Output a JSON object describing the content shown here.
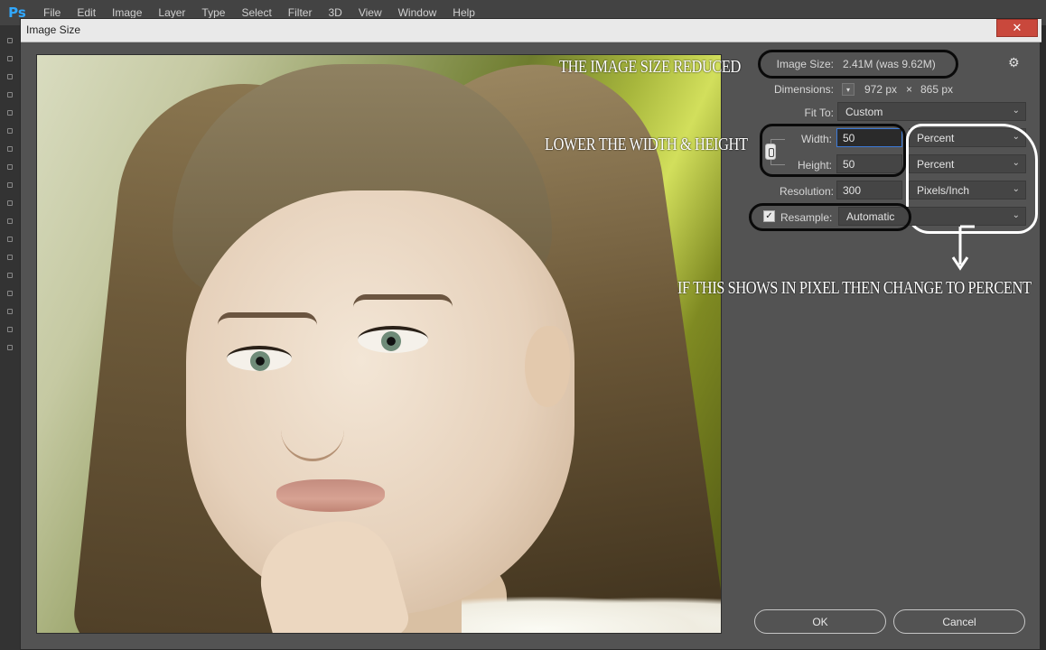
{
  "ps_menubar": {
    "logo": "Ps",
    "items": [
      "File",
      "Edit",
      "Image",
      "Layer",
      "Type",
      "Select",
      "Filter",
      "3D",
      "View",
      "Window",
      "Help"
    ]
  },
  "dialog": {
    "title": "Image Size",
    "close_glyph": "✕"
  },
  "annotations": {
    "size_reduced": "THE IMAGE SIZE REDUCED",
    "lower_wh": "LOWER THE WIDTH & HEIGHT",
    "pixel_to_percent": "IF THIS SHOWS IN PIXEL THEN CHANGE TO PERCENT"
  },
  "panel": {
    "image_size_label": "Image Size:",
    "image_size_value": "2.41M (was 9.62M)",
    "dimensions_label": "Dimensions:",
    "dimensions_width": "972 px",
    "dimensions_times": "×",
    "dimensions_height": "865 px",
    "fit_to_label": "Fit To:",
    "fit_to_value": "Custom",
    "width_label": "Width:",
    "width_value": "50",
    "width_unit": "Percent",
    "height_label": "Height:",
    "height_value": "50",
    "height_unit": "Percent",
    "resolution_label": "Resolution:",
    "resolution_value": "300",
    "resolution_unit": "Pixels/Inch",
    "resample_label": "Resample:",
    "resample_checked_glyph": "✓",
    "resample_value": "Automatic"
  },
  "buttons": {
    "ok": "OK",
    "cancel": "Cancel"
  }
}
